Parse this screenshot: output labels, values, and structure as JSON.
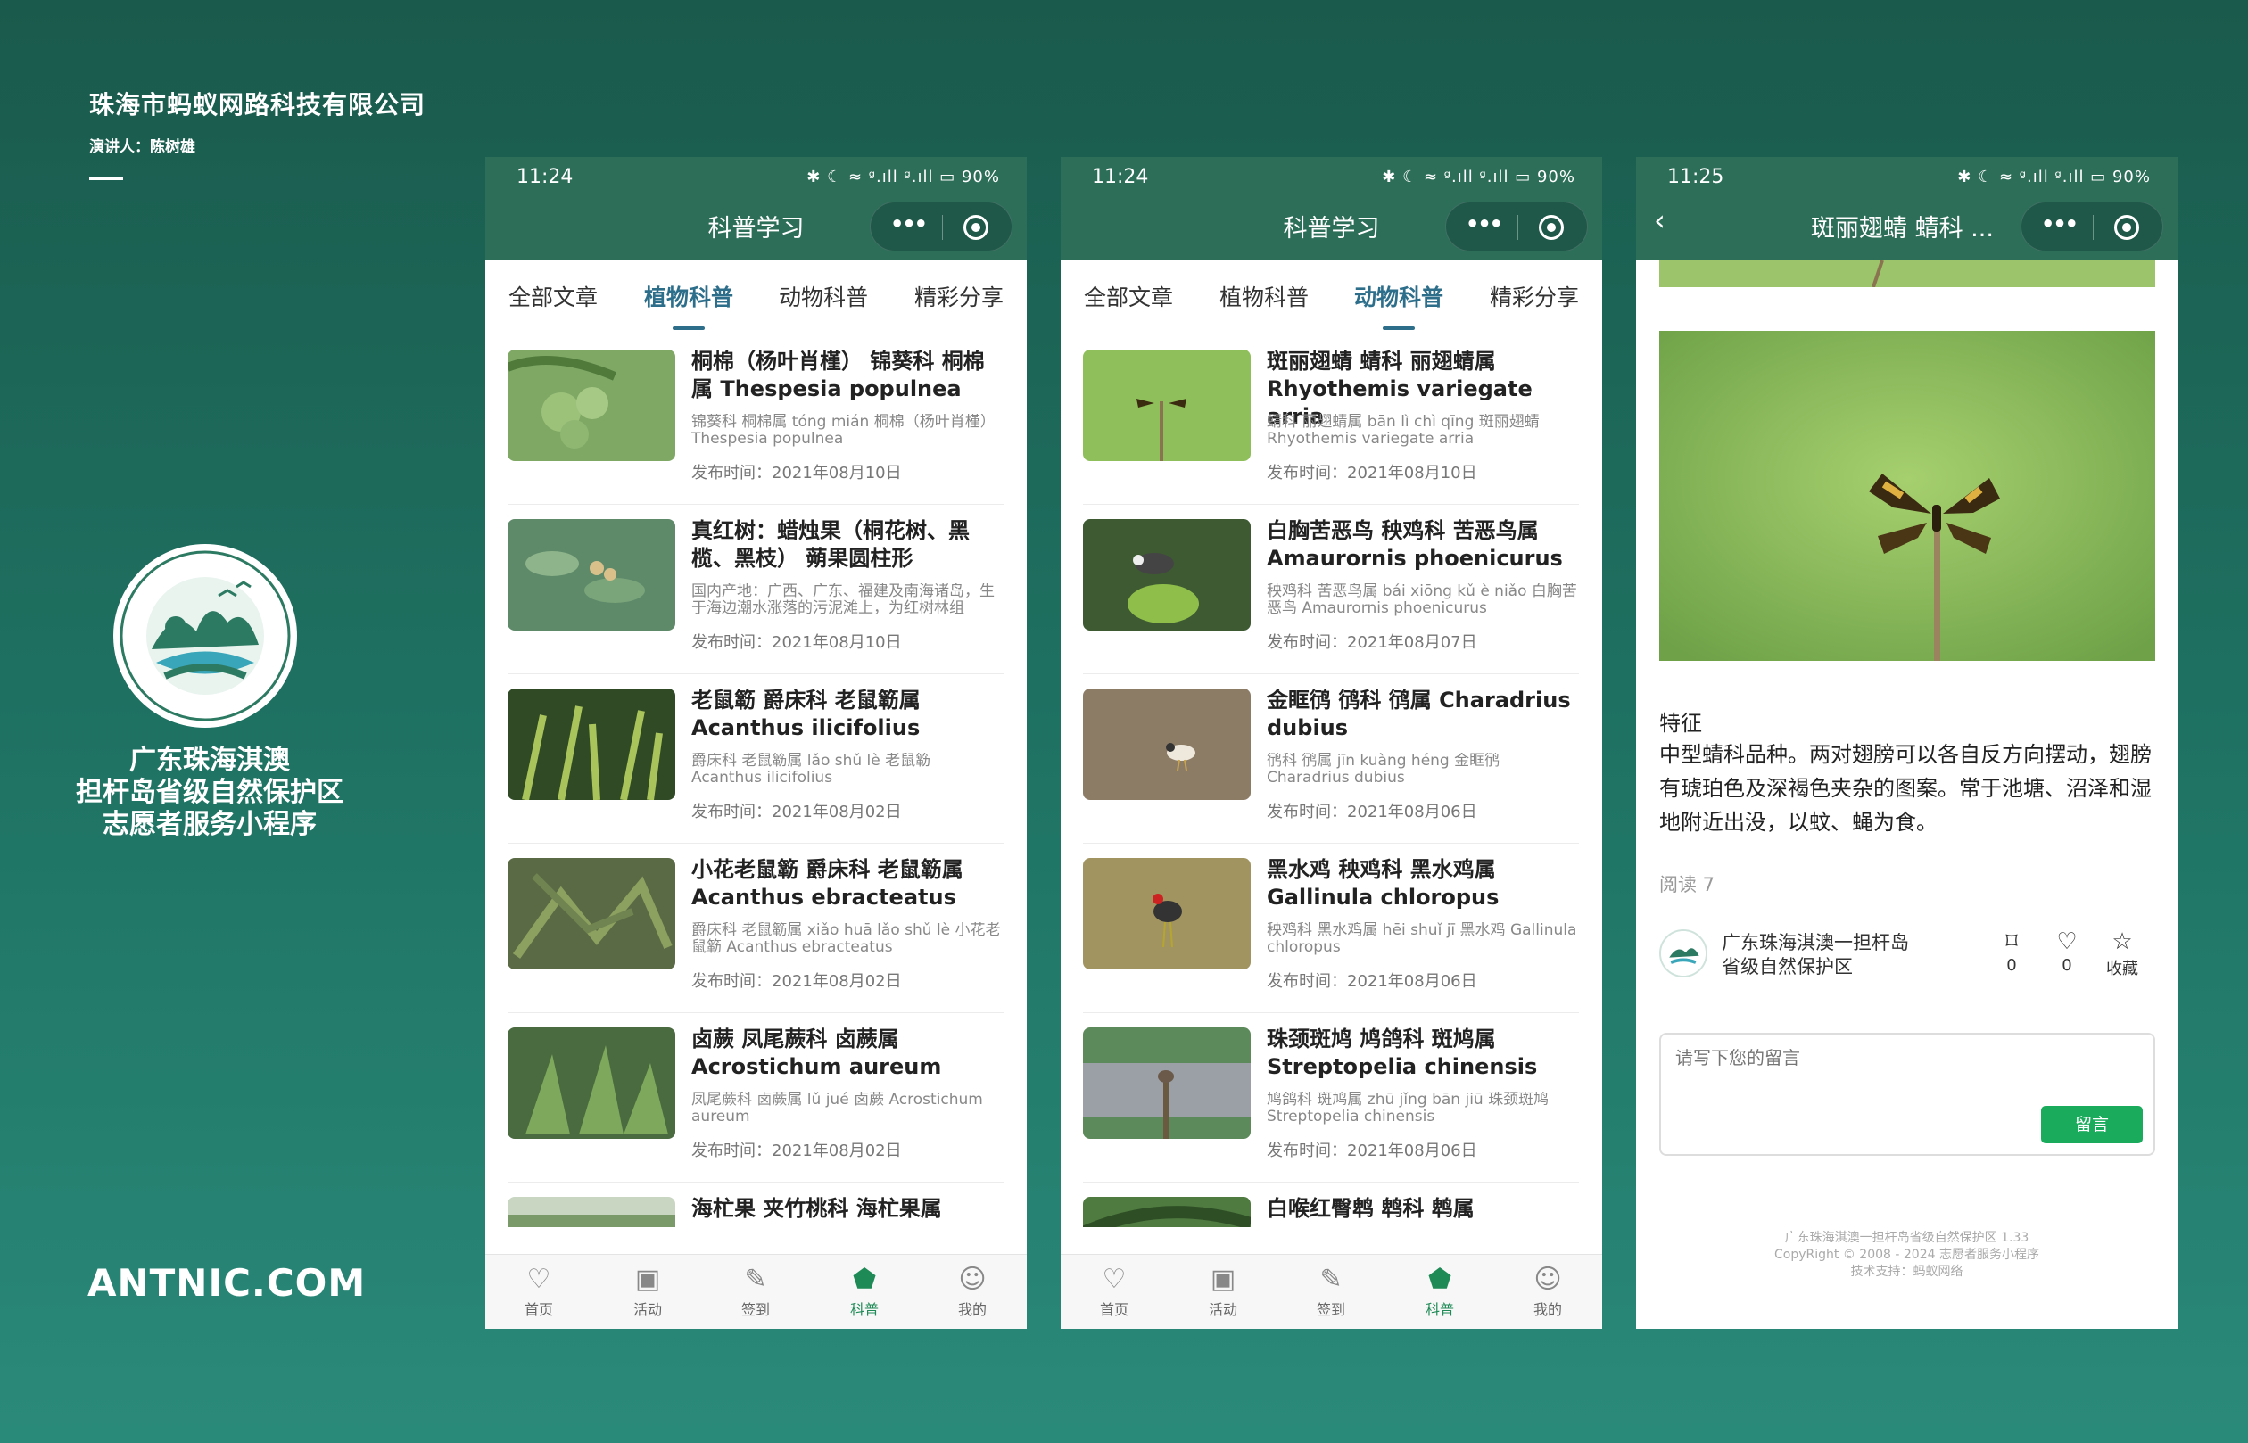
{
  "brand": {
    "company": "珠海市蚂蚁网路科技有限公司",
    "speaker": "演讲人：陈树雄",
    "title_lines": [
      "广东珠海淇澳",
      "担杆岛省级自然保护区",
      "志愿者服务小程序"
    ],
    "website": "ANTNIC.COM",
    "logo_text": "广东珠海淇澳—担杆岛省级自然保护区",
    "colors": {
      "background": "#1f7464",
      "primary": "#2d6e59",
      "accent": "#2d6e8b",
      "active_nav": "#1e8a56"
    }
  },
  "statusbar": {
    "icons": "✱ ☾ ≈ ᵍ.ıll ᵍ.ıll ▭ "
  },
  "phones": [
    {
      "time": "11:24",
      "battery": "90%",
      "title": "科普学习",
      "tabs": [
        "全部文章",
        "植物科普",
        "动物科普",
        "精彩分享"
      ],
      "active_tab": 1,
      "items": [
        {
          "title": "桐棉（杨叶肖槿） 锦葵科 桐棉属 Thespesia populnea",
          "desc": "锦葵科 桐棉属 tóng mián 桐棉（杨叶肖槿） Thespesia populnea",
          "date": "发布时间：2021年08月10日"
        },
        {
          "title": "真红树：蜡烛果（桐花树、黑榄、黑枝） 蒴果圆柱形",
          "desc": "国内产地：广西、广东、福建及南海诸岛，生于海边潮水涨落的污泥滩上，为红树林组",
          "date": "发布时间：2021年08月10日"
        },
        {
          "title": "老鼠簕 爵床科 老鼠簕属 Acanthus ilicifolius",
          "desc": "爵床科 老鼠簕属 lǎo shǔ lè 老鼠簕 Acanthus ilicifolius",
          "date": "发布时间：2021年08月02日"
        },
        {
          "title": "小花老鼠簕 爵床科 老鼠簕属 Acanthus ebracteatus",
          "desc": "爵床科 老鼠簕属 xiǎo huā lǎo shǔ lè 小花老鼠簕 Acanthus ebracteatus",
          "date": "发布时间：2021年08月02日"
        },
        {
          "title": "卤蕨 凤尾蕨科 卤蕨属 Acrostichum aureum",
          "desc": "凤尾蕨科 卤蕨属 lǔ jué 卤蕨 Acrostichum aureum",
          "date": "发布时间：2021年08月02日"
        },
        {
          "title": "海杧果 夹竹桃科 海杧果属",
          "desc": "",
          "date": ""
        }
      ]
    },
    {
      "time": "11:24",
      "battery": "90%",
      "title": "科普学习",
      "tabs": [
        "全部文章",
        "植物科普",
        "动物科普",
        "精彩分享"
      ],
      "active_tab": 2,
      "items": [
        {
          "title": "斑丽翅蜻 蜻科 丽翅蜻属 Rhyothemis variegate arria",
          "desc": "蜻科 丽翅蜻属 bān lì chì qīng 斑丽翅蜻 Rhyothemis variegate arria",
          "date": "发布时间：2021年08月10日"
        },
        {
          "title": "白胸苦恶鸟 秧鸡科 苦恶鸟属 Amaurornis phoenicurus",
          "desc": "秧鸡科 苦恶鸟属 bái xiōng kǔ è niǎo 白胸苦恶鸟 Amaurornis phoenicurus",
          "date": "发布时间：2021年08月07日"
        },
        {
          "title": "金眶鸻 鸻科 鸻属 Charadrius dubius",
          "desc": "鸻科 鸻属 jīn kuàng héng 金眶鸻 Charadrius dubius",
          "date": "发布时间：2021年08月06日"
        },
        {
          "title": "黑水鸡 秧鸡科 黑水鸡属 Gallinula chloropus",
          "desc": "秧鸡科 黑水鸡属 hēi shuǐ jī 黑水鸡 Gallinula chloropus",
          "date": "发布时间：2021年08月06日"
        },
        {
          "title": "珠颈斑鸠 鸠鸽科 斑鸠属 Streptopelia chinensis",
          "desc": "鸠鸽科 斑鸠属 zhū jǐng bān jiū 珠颈斑鸠 Streptopelia chinensis",
          "date": "发布时间：2021年08月06日"
        },
        {
          "title": "白喉红臀鹎 鹎科 鹎属",
          "desc": "",
          "date": ""
        }
      ]
    }
  ],
  "bottom_nav": [
    {
      "label": "首页",
      "icon": "home-icon"
    },
    {
      "label": "活动",
      "icon": "activity-icon"
    },
    {
      "label": "签到",
      "icon": "checkin-icon"
    },
    {
      "label": "科普",
      "icon": "science-icon"
    },
    {
      "label": "我的",
      "icon": "profile-icon"
    }
  ],
  "detail": {
    "time": "11:25",
    "battery": "90%",
    "title": "斑丽翅蜻 蜻科 ...",
    "feature_heading": "特征",
    "feature_text": "中型蜻科品种。两对翅膀可以各自反方向摆动，翅膀有琥珀色及深褐色夹杂的图案。常于池塘、沼泽和湿地附近出没，以蚊、蝇为食。",
    "read_count": "阅读 7",
    "author_lines": [
      "广东珠海淇澳一担杆岛",
      "省级自然保护区"
    ],
    "stats": [
      {
        "icon": "bookmark-icon",
        "value": "0"
      },
      {
        "icon": "heart-icon",
        "value": "0"
      },
      {
        "icon": "star-icon",
        "value": "收藏"
      }
    ],
    "comment_placeholder": "请写下您的留言",
    "comment_button": "留言",
    "footer_lines": [
      "广东珠海淇澳一担杆岛省级自然保护区 1.33",
      "CopyRight © 2008 - 2024 志愿者服务小程序",
      "技术支持：蚂蚁网络"
    ]
  }
}
